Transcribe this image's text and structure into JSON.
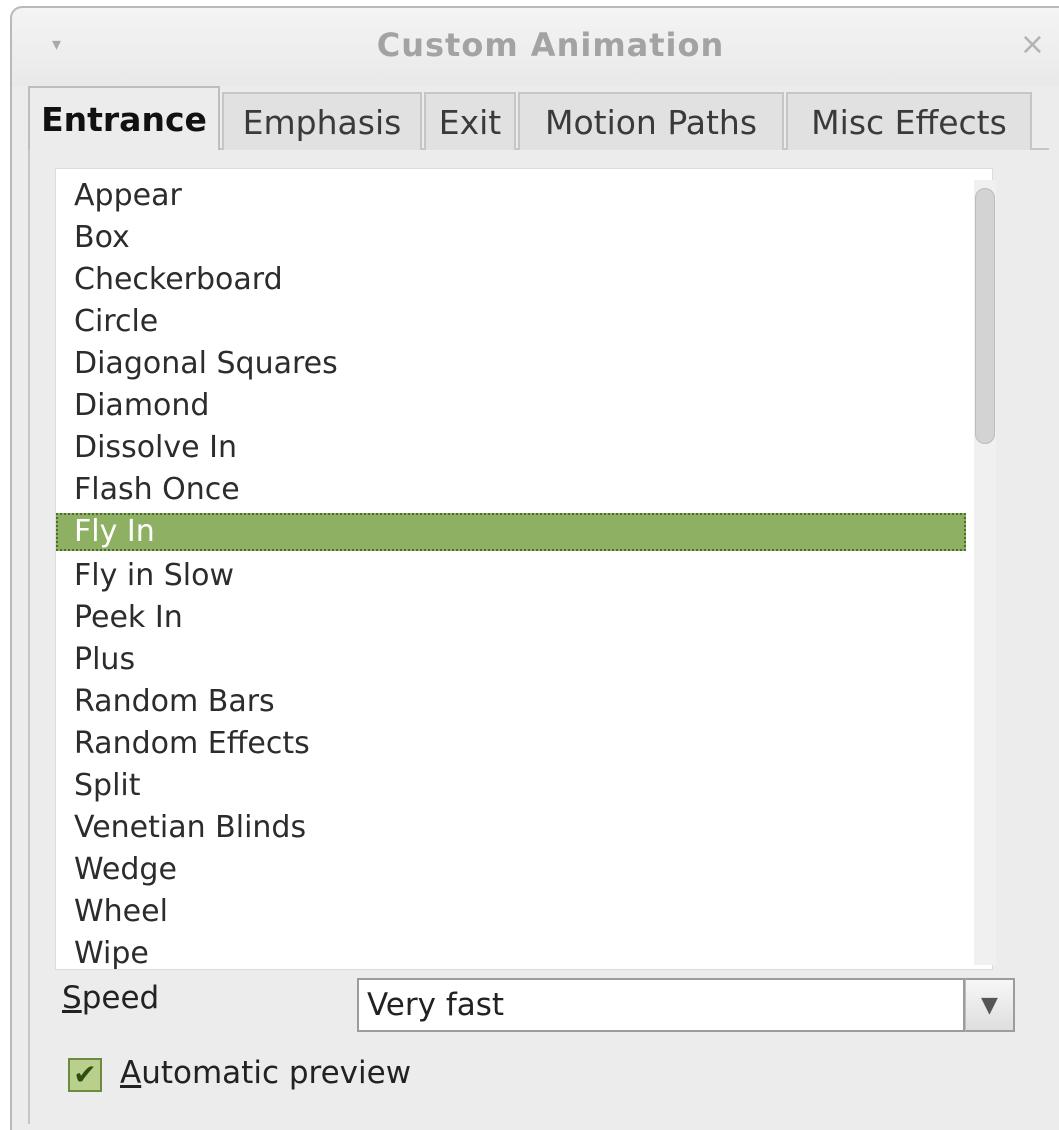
{
  "window": {
    "title": "Custom Animation",
    "menu_glyph": "▾",
    "close_glyph": "×"
  },
  "tabs": [
    {
      "label": "Entrance",
      "active": true
    },
    {
      "label": "Emphasis",
      "active": false
    },
    {
      "label": "Exit",
      "active": false
    },
    {
      "label": "Motion Paths",
      "active": false
    },
    {
      "label": "Misc Effects",
      "active": false
    }
  ],
  "effects": {
    "items": [
      "Appear",
      "Box",
      "Checkerboard",
      "Circle",
      "Diagonal Squares",
      "Diamond",
      "Dissolve In",
      "Flash Once",
      "Fly In",
      "Fly in Slow",
      "Peek In",
      "Plus",
      "Random Bars",
      "Random Effects",
      "Split",
      "Venetian Blinds",
      "Wedge",
      "Wheel",
      "Wipe"
    ],
    "selected": "Fly In"
  },
  "speed": {
    "label_mnemonic": "S",
    "label_rest": "peed",
    "value": "Very fast",
    "dropdown_glyph": "▼"
  },
  "preview": {
    "checked": true,
    "check_glyph": "✔",
    "label_mnemonic": "A",
    "label_rest": "utomatic preview"
  },
  "colors": {
    "selection": "#8db062",
    "checkbox": "#b9d08d"
  }
}
